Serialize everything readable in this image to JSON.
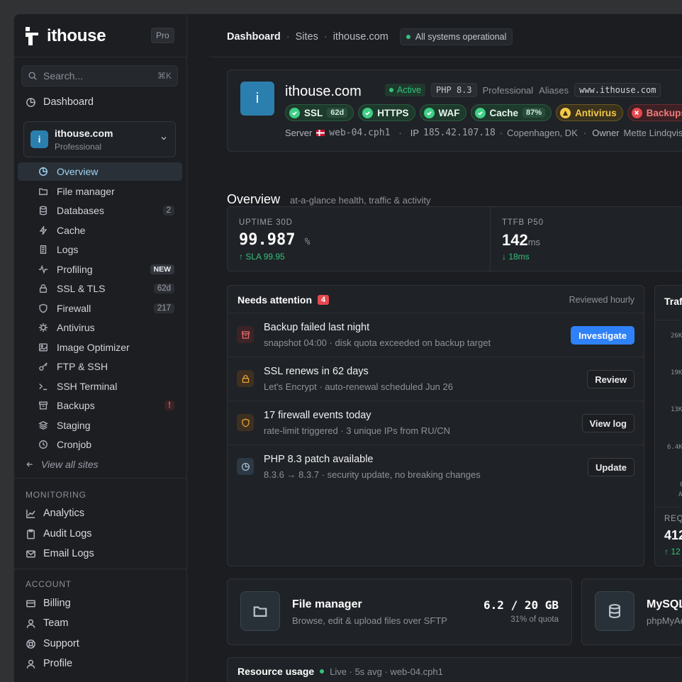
{
  "brand": {
    "name": "ithouse",
    "plan_badge": "Pro"
  },
  "search": {
    "placeholder": "Search...",
    "shortcut": "⌘K"
  },
  "sidebar": {
    "dashboard_label": "Dashboard",
    "site": {
      "initial": "i",
      "name": "ithouse.com",
      "plan": "Professional"
    },
    "site_nav": [
      {
        "label": "Overview",
        "icon": "overview-icon"
      },
      {
        "label": "File manager",
        "icon": "folder-icon"
      },
      {
        "label": "Databases",
        "icon": "database-icon",
        "badge": "2"
      },
      {
        "label": "Cache",
        "icon": "bolt-icon"
      },
      {
        "label": "Logs",
        "icon": "logs-icon"
      },
      {
        "label": "Profiling",
        "icon": "pulse-icon",
        "badge": "NEW"
      },
      {
        "label": "SSL & TLS",
        "icon": "lock-icon",
        "badge": "62d"
      },
      {
        "label": "Firewall",
        "icon": "shield-icon",
        "badge": "217"
      },
      {
        "label": "Antivirus",
        "icon": "virus-icon"
      },
      {
        "label": "Image Optimizer",
        "icon": "image-icon"
      },
      {
        "label": "FTP & SSH",
        "icon": "key-icon"
      },
      {
        "label": "SSH Terminal",
        "icon": "terminal-icon"
      },
      {
        "label": "Backups",
        "icon": "archive-icon",
        "badge": "!"
      },
      {
        "label": "Staging",
        "icon": "layers-icon"
      },
      {
        "label": "Cronjob",
        "icon": "clock-icon"
      }
    ],
    "view_all": "View all sites",
    "monitoring_title": "MONITORING",
    "monitoring": [
      {
        "label": "Analytics",
        "icon": "chart-icon"
      },
      {
        "label": "Audit Logs",
        "icon": "clipboard-icon"
      },
      {
        "label": "Email Logs",
        "icon": "mail-icon"
      }
    ],
    "account_title": "ACCOUNT",
    "account": [
      {
        "label": "Billing",
        "icon": "card-icon"
      },
      {
        "label": "Team",
        "icon": "user-icon"
      },
      {
        "label": "Support",
        "icon": "lifebuoy-icon"
      },
      {
        "label": "Profile",
        "icon": "user-icon"
      }
    ]
  },
  "breadcrumb": {
    "items": [
      "Dashboard",
      "Sites",
      "ithouse.com"
    ],
    "separator": "·",
    "status": "All systems operational"
  },
  "site_header": {
    "initial": "i",
    "name": "ithouse.com",
    "status": "Active",
    "php": "PHP 8.3",
    "plan": "Professional",
    "aliases_label": "Aliases",
    "alias": "www.ithouse.com",
    "chips": [
      {
        "label": "SSL",
        "extra": "62d",
        "state": "ok"
      },
      {
        "label": "HTTPS",
        "state": "ok"
      },
      {
        "label": "WAF",
        "state": "ok"
      },
      {
        "label": "Cache",
        "extra": "87%",
        "state": "ok"
      },
      {
        "label": "Antivirus",
        "state": "warn"
      },
      {
        "label": "Backups",
        "state": "bad"
      }
    ],
    "server_label": "Server",
    "server": "web-04.cph1",
    "ip_label": "IP",
    "ip": "185.42.107.18",
    "location": "Copenhagen, DK",
    "owner_label": "Owner",
    "owner": "Mette Lindqvist"
  },
  "overview": {
    "title": "Overview",
    "subtitle": "at-a-glance health, traffic & activity"
  },
  "kpis": [
    {
      "label": "UPTIME 30D",
      "value": "99.987",
      "unit": "%",
      "delta": "↑ SLA 99.95"
    },
    {
      "label": "TTFB P50",
      "value": "142",
      "unit": "ms",
      "delta": "↓ 18ms"
    }
  ],
  "attention": {
    "title": "Needs attention",
    "count": "4",
    "note": "Reviewed hourly",
    "items": [
      {
        "title": "Backup failed last night",
        "sub": "snapshot 04:00 · disk quota exceeded on backup target",
        "action": "Investigate",
        "tone": "red",
        "icon": "archive-icon"
      },
      {
        "title": "SSL renews in 62 days",
        "sub": "Let's Encrypt · auto-renewal scheduled Jun 26",
        "action": "Review",
        "tone": "amber",
        "icon": "lock-icon"
      },
      {
        "title": "17 firewall events today",
        "sub": "rate-limit triggered · 3 unique IPs from RU/CN",
        "action": "View log",
        "tone": "amber",
        "icon": "shield-icon"
      },
      {
        "title": "PHP 8.3 patch available",
        "sub": "8.3.6 → 8.3.7 · security update, no breaking changes",
        "action": "Update",
        "tone": "slate",
        "icon": "overview-icon"
      }
    ]
  },
  "traffic": {
    "title": "Traf",
    "ticks": [
      "26K",
      "19K",
      "13K",
      "6.4K",
      "0"
    ],
    "axis_start": "A",
    "footer_label": "REQ",
    "footer_value": "412",
    "footer_delta": "↑ 12"
  },
  "file_manager": {
    "title": "File manager",
    "sub": "Browse, edit & upload files over SFTP",
    "usage": "6.2 / 20 GB",
    "quota": "31% of quota"
  },
  "mysql": {
    "title": "MySQL",
    "sub": "phpMyAdmin"
  },
  "resource": {
    "title": "Resource usage",
    "status": "Live · 5s avg · web-04.cph1"
  }
}
